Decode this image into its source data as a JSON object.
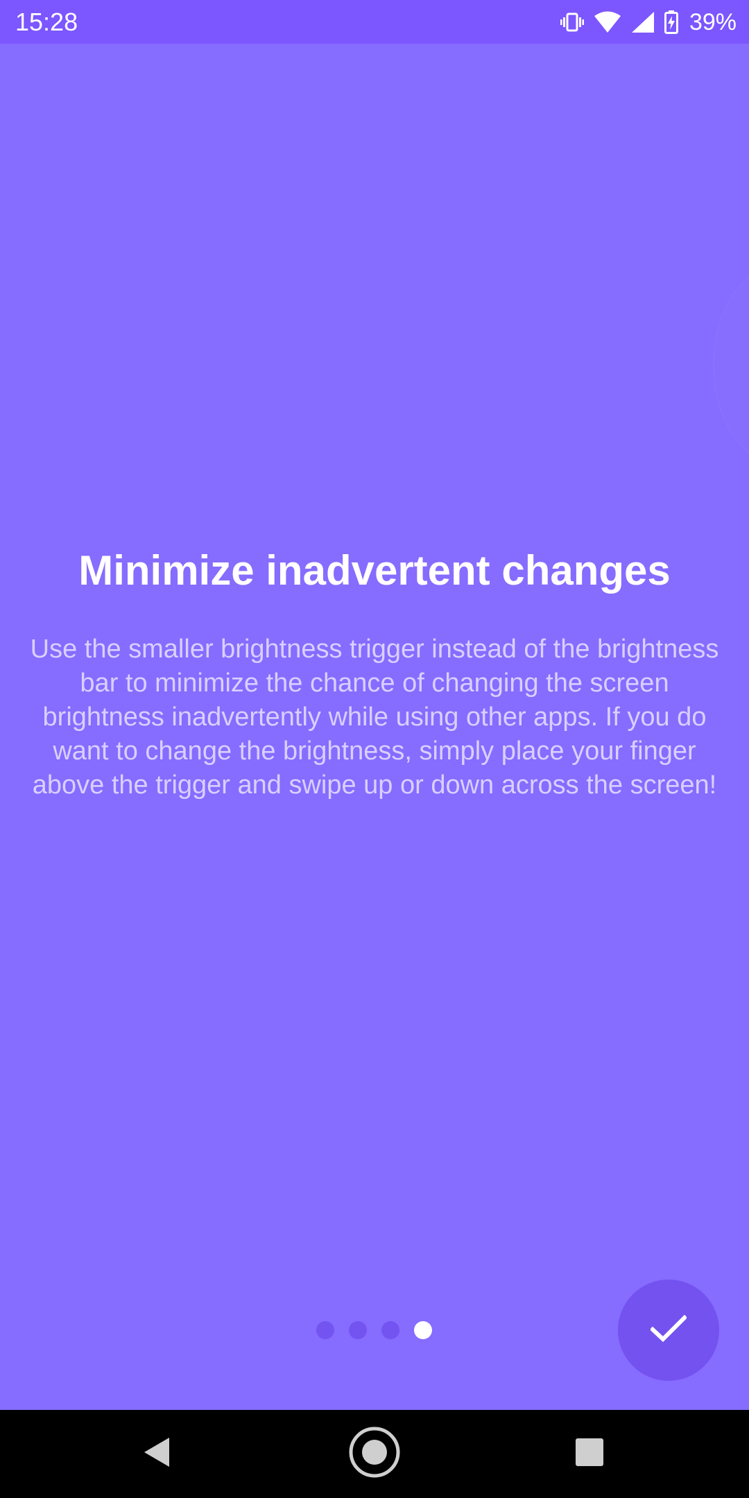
{
  "status_bar": {
    "time": "15:28",
    "battery_percent": "39%",
    "icons": [
      "vibrate-icon",
      "wifi-icon",
      "signal-icon",
      "battery-charging-icon"
    ],
    "background_color": "#7c56ff"
  },
  "slide": {
    "title": "Minimize inadvertent changes",
    "body": "Use the smaller brightness trigger instead of the brightness bar to minimize the chance of changing the screen brightness inadvertently while using other apps. If you do want to change the brightness, simply place your finger above the trigger and swipe up or down across the screen!",
    "background_color": "#866cff"
  },
  "pager": {
    "total_pages": 4,
    "current_page": 4
  },
  "fab": {
    "icon": "check-icon",
    "color": "#7352ef"
  },
  "nav_bar": {
    "buttons": [
      "back-icon",
      "home-icon",
      "recents-icon"
    ]
  }
}
